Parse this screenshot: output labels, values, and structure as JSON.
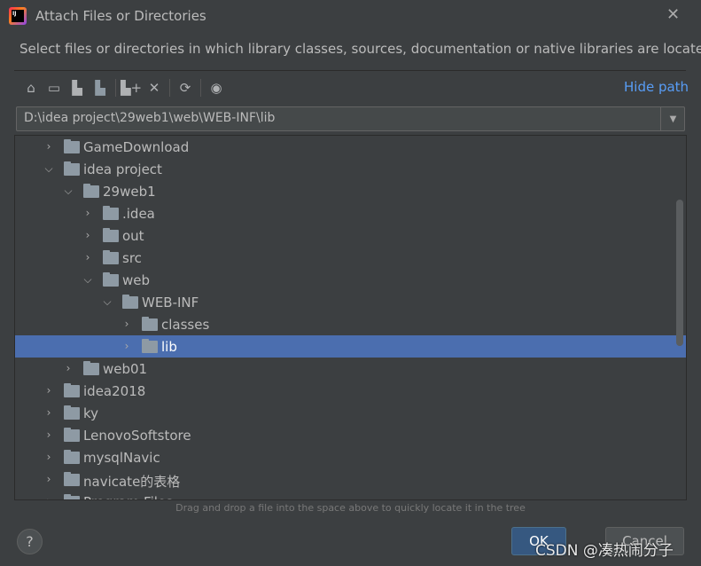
{
  "title": "Attach Files or Directories",
  "description": "Select files or directories in which library classes, sources, documentation or native libraries are located",
  "toolbar": {
    "icons": [
      "home-icon",
      "desktop-icon",
      "project-folder-icon",
      "module-folder-icon",
      "new-folder-icon",
      "delete-icon",
      "refresh-icon",
      "show-hidden-icon"
    ],
    "hide_path": "Hide path"
  },
  "path": "D:\\idea project\\29web1\\web\\WEB-INF\\lib",
  "tree": [
    {
      "label": "GameDownload",
      "level": 0,
      "expanded": false
    },
    {
      "label": "idea project",
      "level": 0,
      "expanded": true
    },
    {
      "label": "29web1",
      "level": 1,
      "expanded": true
    },
    {
      "label": ".idea",
      "level": 2,
      "expanded": false
    },
    {
      "label": "out",
      "level": 2,
      "expanded": false
    },
    {
      "label": "src",
      "level": 2,
      "expanded": false
    },
    {
      "label": "web",
      "level": 2,
      "expanded": true
    },
    {
      "label": "WEB-INF",
      "level": 3,
      "expanded": true
    },
    {
      "label": "classes",
      "level": 4,
      "expanded": false
    },
    {
      "label": "lib",
      "level": 4,
      "expanded": false,
      "selected": true
    },
    {
      "label": "web01",
      "level": 1,
      "expanded": false
    },
    {
      "label": "idea2018",
      "level": 0,
      "expanded": false
    },
    {
      "label": "ky",
      "level": 0,
      "expanded": false
    },
    {
      "label": "LenovoSoftstore",
      "level": 0,
      "expanded": false
    },
    {
      "label": "mysqlNavic",
      "level": 0,
      "expanded": false
    },
    {
      "label": "navicate的表格",
      "level": 0,
      "expanded": false
    },
    {
      "label": "Program Files",
      "level": 0,
      "expanded": false
    }
  ],
  "hint": "Drag and drop a file into the space above to quickly locate it in the tree",
  "buttons": {
    "help": "?",
    "ok": "OK",
    "cancel": "Cancel"
  },
  "watermark": "CSDN @凑热闹分子",
  "colors": {
    "background": "#3c3f41",
    "selection": "#4b6eaf",
    "link": "#589df6",
    "ok": "#365880"
  }
}
